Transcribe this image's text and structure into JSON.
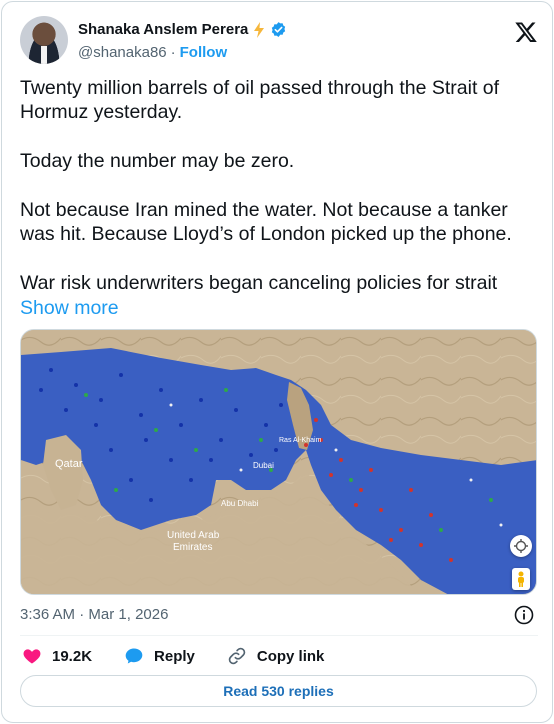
{
  "author": {
    "name": "Shanaka Anslem Perera",
    "handle": "@shanaka86",
    "separator": "·",
    "follow_label": "Follow"
  },
  "icons": {
    "badge": "lightning-bolt-icon",
    "verified": "verified-badge-icon",
    "platform": "x-logo-icon",
    "info": "info-icon",
    "like": "heart-icon",
    "reply": "speech-bubble-icon",
    "copy": "link-icon",
    "map_recenter": "crosshair-icon",
    "map_pegman": "pegman-icon"
  },
  "tweet": {
    "paragraphs": [
      "Twenty million barrels of oil passed through the Strait of Hormuz yesterday.",
      "Today the number may be zero.",
      "Not because Iran mined the water. Not because a tanker was hit. Because Lloyd’s of London picked up the phone.",
      "War risk underwriters began canceling policies for strait"
    ],
    "show_more": "Show more"
  },
  "map": {
    "labels": {
      "qatar": "Qatar",
      "uae_line1": "United Arab",
      "uae_line2": "Emirates",
      "dubai": "Dubai",
      "abu_dhabi": "Abu Dhabi",
      "ras_al_khaimah": "Ras Al-Khaim"
    }
  },
  "meta": {
    "time": "3:36 AM",
    "separator": "·",
    "date": "Mar 1, 2026"
  },
  "actions": {
    "likes": "19.2K",
    "reply": "Reply",
    "copy_link": "Copy link"
  },
  "read_replies": "Read 530 replies",
  "colors": {
    "accent": "#1d9bf0",
    "heart": "#f91880",
    "sea": "#3a5fc2",
    "land": "#c7b393",
    "verified": "#1d9bf0",
    "bolt": "#f6b73c"
  }
}
